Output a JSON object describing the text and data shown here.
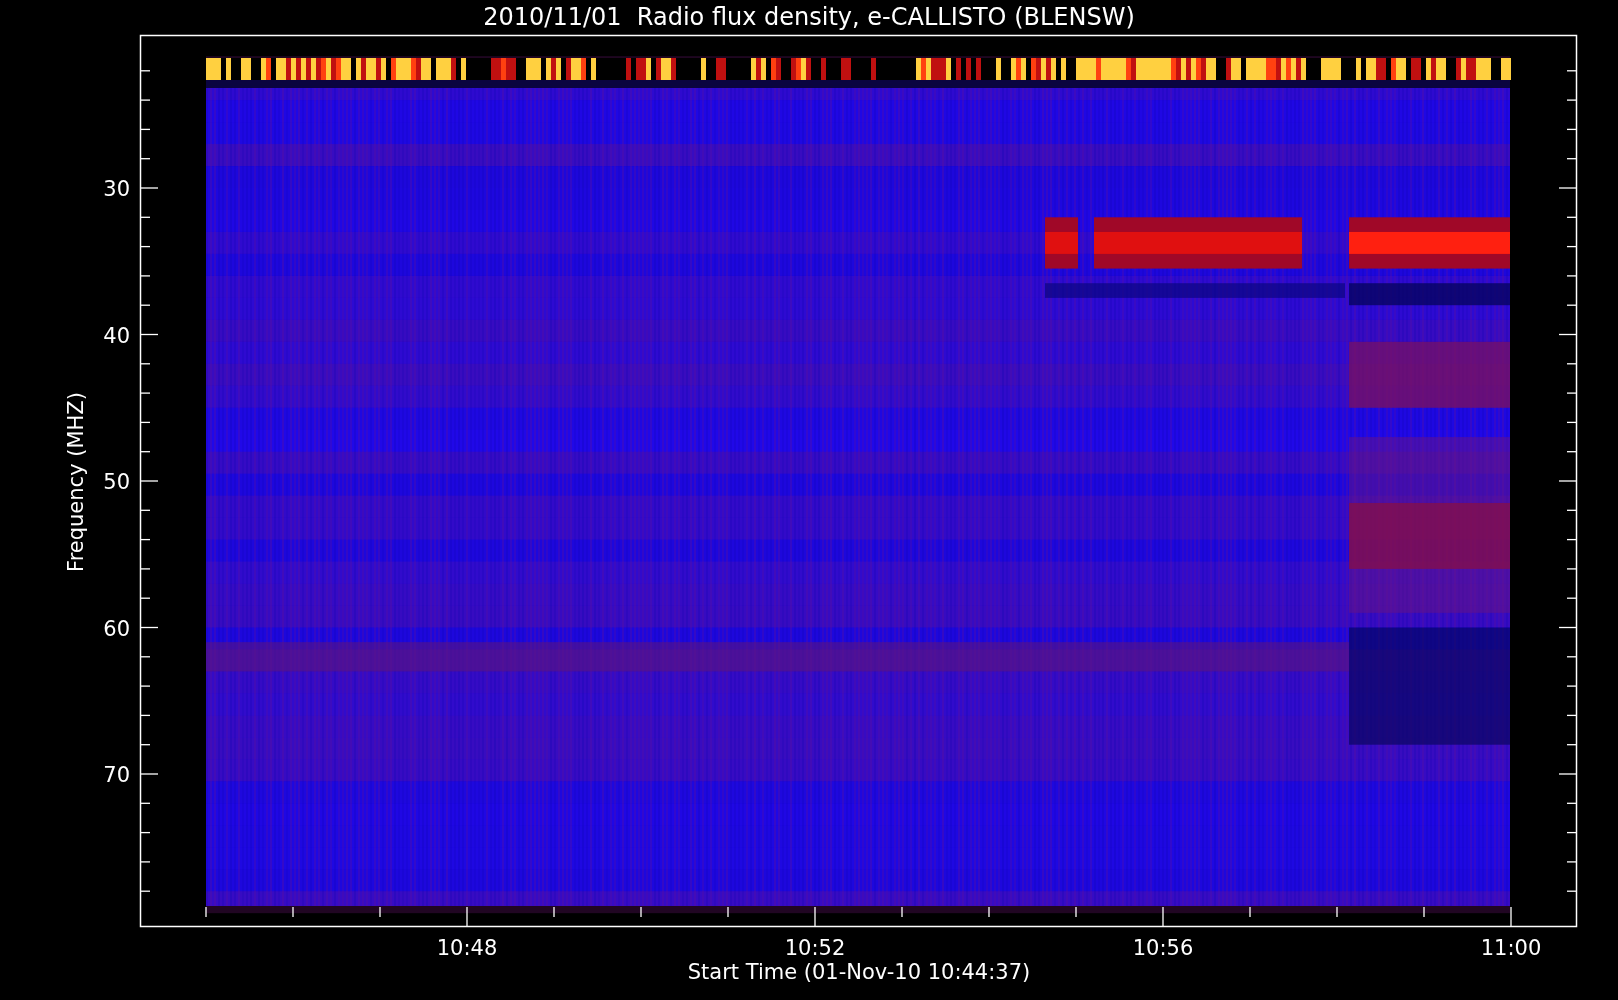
{
  "title": "2010/11/01  Radio flux density, e-CALLISTO (BLENSW)",
  "y_axis": {
    "label": "Frequency (MHZ)",
    "ticks": [
      "30",
      "40",
      "50",
      "60",
      "70"
    ]
  },
  "x_axis": {
    "label": "Start Time (01-Nov-10 10:44:37)",
    "ticks": [
      "10:48",
      "10:52",
      "10:56",
      "11:00"
    ]
  }
}
